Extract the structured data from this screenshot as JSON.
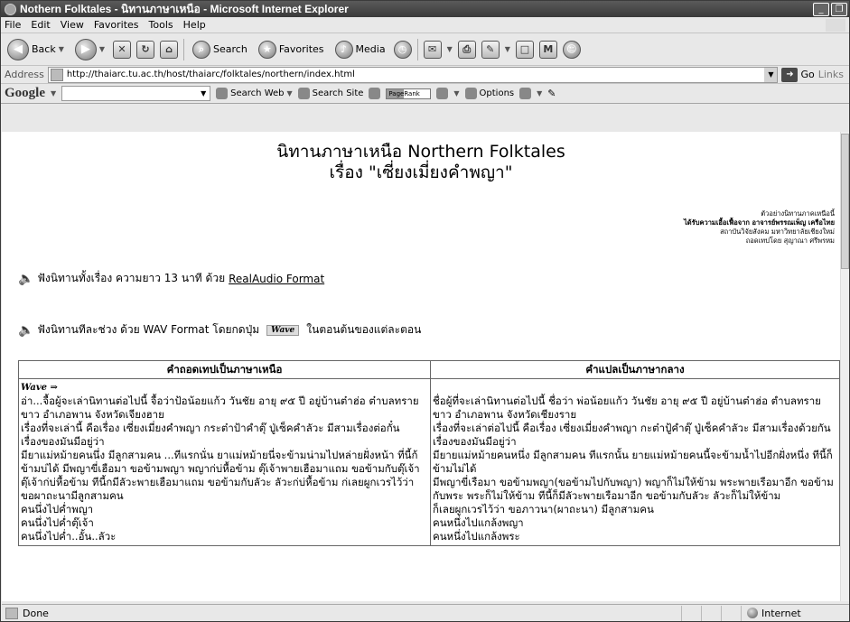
{
  "window": {
    "title": "Nothern Folktales - นิทานภาษาเหนือ - Microsoft Internet Explorer",
    "controls": [
      "_",
      "❐",
      "✕"
    ]
  },
  "menu": [
    "File",
    "Edit",
    "View",
    "Favorites",
    "Tools",
    "Help"
  ],
  "toolbar": {
    "back": "Back",
    "search": "Search",
    "favorites": "Favorites",
    "media": "Media"
  },
  "address": {
    "label": "Address",
    "url": "http://thaiarc.tu.ac.th/host/thaiarc/folktales/northern/index.html",
    "go": "Go",
    "links": "Links"
  },
  "google": {
    "logo": "Google",
    "search_web": "Search Web",
    "search_site": "Search Site",
    "pagerank": "PageRank",
    "options": "Options"
  },
  "page": {
    "title_line1": "นิทานภาษาเหนือ Northern Folktales",
    "title_line2": "เรื่อง \"เซี่ยงเมี่ยงคำพญา\"",
    "credits": [
      "ตัวอย่างนิทานภาคเหนือนี้",
      "ได้รับความเอื้อเฟื้อจาก อาจารย์พรรณเพ็ญ เครือไทย",
      "สถาบันวิจัยสังคม มหาวิทยาลัยเชียงใหม่",
      "ถอดเทปโดย สุญาณา ศรีพรหม"
    ],
    "audio_full_text": "ฟังนิทานทั้งเรื่อง ความยาว 13 นาที ด้วย",
    "audio_full_link": "RealAudio Format",
    "audio_part_text": "ฟังนิทานทีละช่วง ด้วย WAV Format โดยกดปุ่ม",
    "wave_label": "Wave",
    "audio_part_suffix": "ในตอนต้นของแต่ละตอน"
  },
  "table": {
    "headers": [
      "คำถอดเทปเป็นภาษาเหนือ",
      "คำแปลเป็นภาษากลาง"
    ],
    "wave_hint": "Wave ⇒",
    "left": [
      "อ่า...จื้อผู้จะเล่านิทานต่อไปนี้ จื้อว่าป้อน้อยแก้ว วันชัย อายุ ๙๕ ปี อยู่บ้านต๋าฮ่อ ต๋าบลทรายขาว อำเภอพาน จังหวัดเจียงฮาย",
      "เรื่องที่จะเล่านี้ คือเรื่อง เซี่ยงเมี่ยงคำพญา กระต๋าป้าคำตุ๊ ปู่เซ็คคำลัวะ มีสามเรื่องต่อกั๋น",
      "เรื่องของมันมีอยู่ว่า",
      "มียาแม่หม้ายคนนึ่ง มีลูกสามคน ...ทีแรกนั่น ยาแม่หม้ายนี่จะข้ามน่ามไปหล่ายฝั่งหน้า ที่นี้ก้ข้ามบ่ได้ มีพญาขี่เฮือมา ขอข้ามพญา พญาก่บ่หื้อข้าม ตุ๊เจ้าพายเฮือมาแถม ขอข้ามกับตุ๊เจ้า ตุ๊เจ้าก่บ่หื้อข้าม ทีนี้กมีลัวะพายเฮือมาแถม ขอข้ามกับลัวะ ลัวะก่บ่หื้อข้าม ก่เลยผูกเวรไว้ว่า ขอผาถะนามีลูกสามคน",
      "คนนึ่งไปค่ำพญา",
      "คนนึ่งไปค่ำตุ๊เจ้า",
      "คนนึ่งไปค่ำ..อั้น..ลัวะ"
    ],
    "right": [
      "ชื่อผู้ที่จะเล่านิทานต่อไปนี้ ชื่อว่า พ่อน้อยแก้ว วันชัย อายุ ๙๕ ปี อยู่บ้านต๋าฮ่อ ตำบลทรายขาว อำเภอพาน จังหวัดเชียงราย",
      "เรื่องที่จะเล่าต่อไปนี้ คือเรื่อง เซี่ยงเมี่ยงคำพญา กะต๋าปู้คำตุ๊ ปู่เซ็คคำลัวะ มีสามเรื่องด้วยกัน",
      "เรื่องของมันมีอยู่ว่า",
      "มียายแม่หม้ายคนหนึ่ง มีลูกสามคน ทีแรกนั้น ยายแม่หม้ายคนนี้จะข้ามน้ำไปอีกฝั่งหนึ่ง ทีนี้ก็ข้ามไม่ได้",
      "มีพญาขี่เรือมา ขอข้ามพญา(ขอข้ามไปกับพญา) พญาก็ไม่ให้ข้าม พระพายเรือมาอีก ขอข้ามกับพระ พระก็ไม่ให้ข้าม ทีนี้ก็มีลัวะพายเรือมาอีก ขอข้ามกับลัวะ ลัวะก็ไม่ให้ข้าม",
      "ก็เลยผูกเวรไว้ว่า ขอภาวนา(ผาถะนา) มีลูกสามคน",
      "คนหนึ่งไปแกล้งพญา",
      "คนหนึ่งไปแกล้งพระ"
    ]
  },
  "status": {
    "text": "Done",
    "zone": "Internet"
  }
}
